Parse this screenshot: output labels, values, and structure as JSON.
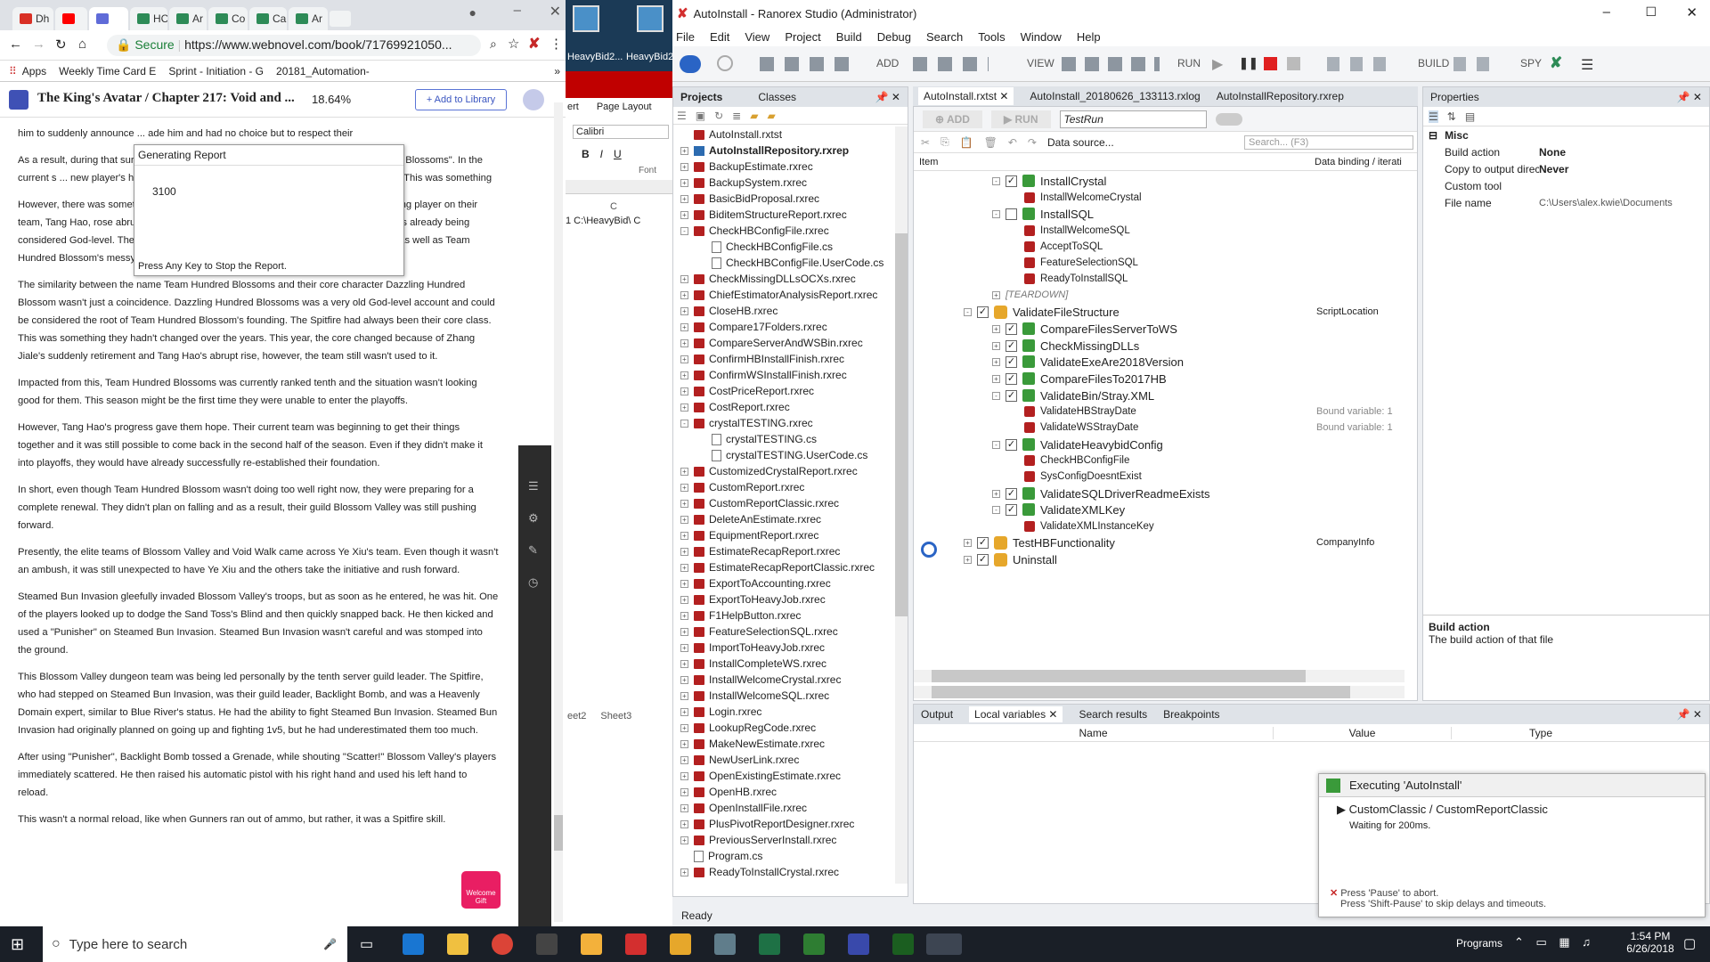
{
  "chrome": {
    "tabs": [
      {
        "label": "Dh",
        "color": "#d93025"
      },
      {
        "label": "",
        "color": "#ff0000"
      },
      {
        "label": "",
        "color": "#5f6bd8"
      },
      {
        "label": "HC",
        "color": "#2e8b57"
      },
      {
        "label": "Ar",
        "color": "#2e8b57"
      },
      {
        "label": "Co",
        "color": "#2e8b57"
      },
      {
        "label": "Ca",
        "color": "#2e8b57"
      },
      {
        "label": "Ar",
        "color": "#2e8b57"
      }
    ],
    "secure_label": "Secure",
    "url": "https://www.webnovel.com/book/71769921050...",
    "bookmarks": [
      "Apps",
      "Weekly Time Card E",
      "Sprint - Initiation - G",
      "20181_Automation-"
    ],
    "novel_title": "The King's Avatar / Chapter 217: Void and ...",
    "progress": "18.64%",
    "add_library": "+ Add to Library",
    "paragraphs": [
      "him to suddenly announce ... ade him and had no choice but to respect their",
      "As a result, during that sur ... someone to replace him. However, in the end, ... Hundred Blossoms\". In the current s ... new player's hands. The new player's performa ... become the team's core. This was something",
      "However, there was something this season that made them pleasantly surprised. A young player on their team, Tang Hao, rose abruptly during his second year as a pro and his performance was already being considered God-level. The only thing restricting him was his average Brawler account, as well as Team Hundred Blossom's messy playing.",
      "The similarity between the name Team Hundred Blossoms and their core character Dazzling Hundred Blossom wasn't just a coincidence. Dazzling Hundred Blossoms was a very old God-level account and could be considered the root of Team Hundred Blossom's founding. The Spitfire had always been their core class. This was something they hadn't changed over the years. This year, the core changed because of Zhang Jiale's suddenly retirement and Tang Hao's abrupt rise, however, the team still wasn't used to it.",
      "Impacted from this, Team Hundred Blossoms was currently ranked tenth and the situation wasn't looking good for them. This season might be the first time they were unable to enter the playoffs.",
      "However, Tang Hao's progress gave them hope. Their current team was beginning to get their things together and it was still possible to come back in the second half of the season. Even if they didn't make it into playoffs, they would have already successfully re-established their foundation.",
      "In short, even though Team Hundred Blossom wasn't doing too well right now, they were preparing for a complete renewal. They didn't plan on falling and as a result, their guild Blossom Valley was still pushing forward.",
      "Presently, the elite teams of Blossom Valley and Void Walk came across Ye Xiu's team. Even though it wasn't an ambush, it was still unexpected to have Ye Xiu and the others take the initiative and rush forward.",
      "Steamed Bun Invasion gleefully invaded Blossom Valley's troops, but as soon as he entered, he was hit. One of the players looked up to dodge the Sand Toss's Blind and then quickly snapped back. He then kicked and used a \"Punisher\" on Steamed Bun Invasion. Steamed Bun Invasion wasn't careful and was stomped into the ground.",
      "This Blossom Valley dungeon team was being led personally by the tenth server guild leader. The Spitfire, who had stepped on Steamed Bun Invasion, was their guild leader, Backlight Bomb, and was a Heavenly Domain expert, similar to Blue River's status. He had the ability to fight Steamed Bun Invasion. Steamed Bun Invasion had originally planned on going up and fighting 1v5, but he had underestimated them too much.",
      "After using \"Punisher\", Backlight Bomb tossed a Grenade, while shouting \"Scatter!\" Blossom Valley's players immediately scattered. He then raised his automatic pistol with his right hand and used his left hand to reload.",
      "This wasn't a normal reload, like when Gunners ran out of ammo, but rather, it was a Spitfire skill."
    ],
    "welcome_gift": "Welcome Gift"
  },
  "report_popup": {
    "title": "Generating Report",
    "value": "3100",
    "hint": "Press Any Key to Stop the Report."
  },
  "desktop": {
    "icons": [
      "HeavyBid2...",
      "HeavyBid2..."
    ]
  },
  "excel": {
    "tab": "ert",
    "page_layout": "Page Layout",
    "font": "Calibri",
    "font_group": "Font",
    "col": "C",
    "cell": "1  C:\\HeavyBid\\  C",
    "sheets": [
      "eet2",
      "Sheet3"
    ]
  },
  "ranorex": {
    "title": "AutoInstall - Ranorex Studio (Administrator)",
    "menu": [
      "File",
      "Edit",
      "View",
      "Project",
      "Build",
      "Debug",
      "Search",
      "Tools",
      "Window",
      "Help"
    ],
    "toolbar": {
      "add": "ADD",
      "view": "VIEW",
      "run": "RUN",
      "build": "BUILD",
      "spy": "SPY"
    },
    "project_tabs": [
      "Projects",
      "Classes"
    ],
    "project_items": [
      {
        "t": "AutoInstall.rxtst",
        "i": "red",
        "lvl": 0,
        "pm": ""
      },
      {
        "t": "AutoInstallRepository.rxrep",
        "i": "rep",
        "lvl": 0,
        "pm": "+",
        "bold": true
      },
      {
        "t": "BackupEstimate.rxrec",
        "i": "red",
        "lvl": 0,
        "pm": "+"
      },
      {
        "t": "BackupSystem.rxrec",
        "i": "red",
        "lvl": 0,
        "pm": "+"
      },
      {
        "t": "BasicBidProposal.rxrec",
        "i": "red",
        "lvl": 0,
        "pm": "+"
      },
      {
        "t": "BiditemStructureReport.rxrec",
        "i": "red",
        "lvl": 0,
        "pm": "+"
      },
      {
        "t": "CheckHBConfigFile.rxrec",
        "i": "red",
        "lvl": 0,
        "pm": "-"
      },
      {
        "t": "CheckHBConfigFile.cs",
        "i": "cs",
        "lvl": 1,
        "pm": ""
      },
      {
        "t": "CheckHBConfigFile.UserCode.cs",
        "i": "cs",
        "lvl": 1,
        "pm": ""
      },
      {
        "t": "CheckMissingDLLsOCXs.rxrec",
        "i": "red",
        "lvl": 0,
        "pm": "+"
      },
      {
        "t": "ChiefEstimatorAnalysisReport.rxrec",
        "i": "red",
        "lvl": 0,
        "pm": "+"
      },
      {
        "t": "CloseHB.rxrec",
        "i": "red",
        "lvl": 0,
        "pm": "+"
      },
      {
        "t": "Compare17Folders.rxrec",
        "i": "red",
        "lvl": 0,
        "pm": "+"
      },
      {
        "t": "CompareServerAndWSBin.rxrec",
        "i": "red",
        "lvl": 0,
        "pm": "+"
      },
      {
        "t": "ConfirmHBInstallFinish.rxrec",
        "i": "red",
        "lvl": 0,
        "pm": "+"
      },
      {
        "t": "ConfirmWSInstallFinish.rxrec",
        "i": "red",
        "lvl": 0,
        "pm": "+"
      },
      {
        "t": "CostPriceReport.rxrec",
        "i": "red",
        "lvl": 0,
        "pm": "+"
      },
      {
        "t": "CostReport.rxrec",
        "i": "red",
        "lvl": 0,
        "pm": "+"
      },
      {
        "t": "crystalTESTING.rxrec",
        "i": "red",
        "lvl": 0,
        "pm": "-"
      },
      {
        "t": "crystalTESTING.cs",
        "i": "cs",
        "lvl": 1,
        "pm": ""
      },
      {
        "t": "crystalTESTING.UserCode.cs",
        "i": "cs",
        "lvl": 1,
        "pm": ""
      },
      {
        "t": "CustomizedCrystalReport.rxrec",
        "i": "red",
        "lvl": 0,
        "pm": "+"
      },
      {
        "t": "CustomReport.rxrec",
        "i": "red",
        "lvl": 0,
        "pm": "+"
      },
      {
        "t": "CustomReportClassic.rxrec",
        "i": "red",
        "lvl": 0,
        "pm": "+"
      },
      {
        "t": "DeleteAnEstimate.rxrec",
        "i": "red",
        "lvl": 0,
        "pm": "+"
      },
      {
        "t": "EquipmentReport.rxrec",
        "i": "red",
        "lvl": 0,
        "pm": "+"
      },
      {
        "t": "EstimateRecapReport.rxrec",
        "i": "red",
        "lvl": 0,
        "pm": "+"
      },
      {
        "t": "EstimateRecapReportClassic.rxrec",
        "i": "red",
        "lvl": 0,
        "pm": "+"
      },
      {
        "t": "ExportToAccounting.rxrec",
        "i": "red",
        "lvl": 0,
        "pm": "+"
      },
      {
        "t": "ExportToHeavyJob.rxrec",
        "i": "red",
        "lvl": 0,
        "pm": "+"
      },
      {
        "t": "F1HelpButton.rxrec",
        "i": "red",
        "lvl": 0,
        "pm": "+"
      },
      {
        "t": "FeatureSelectionSQL.rxrec",
        "i": "red",
        "lvl": 0,
        "pm": "+"
      },
      {
        "t": "ImportToHeavyJob.rxrec",
        "i": "red",
        "lvl": 0,
        "pm": "+"
      },
      {
        "t": "InstallCompleteWS.rxrec",
        "i": "red",
        "lvl": 0,
        "pm": "+"
      },
      {
        "t": "InstallWelcomeCrystal.rxrec",
        "i": "red",
        "lvl": 0,
        "pm": "+"
      },
      {
        "t": "InstallWelcomeSQL.rxrec",
        "i": "red",
        "lvl": 0,
        "pm": "+"
      },
      {
        "t": "Login.rxrec",
        "i": "red",
        "lvl": 0,
        "pm": "+"
      },
      {
        "t": "LookupRegCode.rxrec",
        "i": "red",
        "lvl": 0,
        "pm": "+"
      },
      {
        "t": "MakeNewEstimate.rxrec",
        "i": "red",
        "lvl": 0,
        "pm": "+"
      },
      {
        "t": "NewUserLink.rxrec",
        "i": "red",
        "lvl": 0,
        "pm": "+"
      },
      {
        "t": "OpenExistingEstimate.rxrec",
        "i": "red",
        "lvl": 0,
        "pm": "+"
      },
      {
        "t": "OpenHB.rxrec",
        "i": "red",
        "lvl": 0,
        "pm": "+"
      },
      {
        "t": "OpenInstallFile.rxrec",
        "i": "red",
        "lvl": 0,
        "pm": "+"
      },
      {
        "t": "PlusPivotReportDesigner.rxrec",
        "i": "red",
        "lvl": 0,
        "pm": "+"
      },
      {
        "t": "PreviousServerInstall.rxrec",
        "i": "red",
        "lvl": 0,
        "pm": "+"
      },
      {
        "t": "Program.cs",
        "i": "cs",
        "lvl": 0,
        "pm": ""
      },
      {
        "t": "ReadyToInstallCrystal.rxrec",
        "i": "red",
        "lvl": 0,
        "pm": "+"
      }
    ],
    "doc_tabs": [
      "AutoInstall.rxtst",
      "AutoInstall_20180626_133113.rxlog",
      "AutoInstallRepository.rxrep"
    ],
    "suite_toolbar": {
      "add": "ADD",
      "run": "RUN",
      "testrun": "TestRun",
      "datasource": "Data source...",
      "search": "Search... (F3)"
    },
    "suite_cols": [
      "Item",
      "Data binding / iterati"
    ],
    "suite_rows": [
      {
        "t": "InstallCrystal",
        "k": "tc",
        "lvl": 2,
        "cb": "x",
        "pm": "-"
      },
      {
        "t": "InstallWelcomeCrystal",
        "k": "mod",
        "lvl": 3
      },
      {
        "t": "InstallSQL",
        "k": "tc",
        "lvl": 2,
        "cb": " ",
        "pm": "-"
      },
      {
        "t": "InstallWelcomeSQL",
        "k": "mod",
        "lvl": 3
      },
      {
        "t": "AcceptToSQL",
        "k": "mod",
        "lvl": 3
      },
      {
        "t": "FeatureSelectionSQL",
        "k": "mod",
        "lvl": 3
      },
      {
        "t": "ReadyToInstallSQL",
        "k": "mod",
        "lvl": 3
      },
      {
        "t": "[TEARDOWN]",
        "k": "td",
        "lvl": 2,
        "pm": "+"
      },
      {
        "t": "ValidateFileStructure",
        "k": "gear",
        "lvl": 1,
        "cb": "x",
        "pm": "-",
        "bind": "ScriptLocation"
      },
      {
        "t": "CompareFilesServerToWS",
        "k": "tc",
        "lvl": 2,
        "cb": "x",
        "pm": "+"
      },
      {
        "t": "CheckMissingDLLs",
        "k": "tc",
        "lvl": 2,
        "cb": "x",
        "pm": "+"
      },
      {
        "t": "ValidateExeAre2018Version",
        "k": "tc",
        "lvl": 2,
        "cb": "x",
        "pm": "+"
      },
      {
        "t": "CompareFilesTo2017HB",
        "k": "tc",
        "lvl": 2,
        "cb": "x",
        "pm": "+"
      },
      {
        "t": "ValidateBin/Stray.XML",
        "k": "tc",
        "lvl": 2,
        "cb": "x",
        "pm": "-"
      },
      {
        "t": "ValidateHBStrayDate",
        "k": "mod",
        "lvl": 3,
        "bind": "Bound variable: 1"
      },
      {
        "t": "ValidateWSStrayDate",
        "k": "mod",
        "lvl": 3,
        "bind": "Bound variable: 1"
      },
      {
        "t": "ValidateHeavybidConfig",
        "k": "tc",
        "lvl": 2,
        "cb": "x",
        "pm": "-"
      },
      {
        "t": "CheckHBConfigFile",
        "k": "mod",
        "lvl": 3
      },
      {
        "t": "SysConfigDoesntExist",
        "k": "mod",
        "lvl": 3
      },
      {
        "t": "ValidateSQLDriverReadmeExists",
        "k": "tc",
        "lvl": 2,
        "cb": "x",
        "pm": "+"
      },
      {
        "t": "ValidateXMLKey",
        "k": "tc",
        "lvl": 2,
        "cb": "x",
        "pm": "-"
      },
      {
        "t": "ValidateXMLInstanceKey",
        "k": "mod",
        "lvl": 3
      },
      {
        "t": "TestHBFunctionality",
        "k": "gear",
        "lvl": 1,
        "cb": "x",
        "pm": "+",
        "bind": "CompanyInfo"
      },
      {
        "t": "Uninstall",
        "k": "gear",
        "lvl": 1,
        "cb": "x",
        "pm": "+"
      }
    ],
    "properties": {
      "title": "Properties",
      "category": "Misc",
      "rows": [
        {
          "k": "Build action",
          "v": "None"
        },
        {
          "k": "Copy to output director",
          "v": "Never"
        },
        {
          "k": "Custom tool",
          "v": ""
        },
        {
          "k": "File name",
          "v": "C:\\Users\\alex.kwie\\Documents"
        }
      ],
      "desc_title": "Build action",
      "desc_text": "The build action of that file"
    },
    "bottom_tabs": [
      "Output",
      "Local variables",
      "Search results",
      "Breakpoints"
    ],
    "bottom_cols": [
      "Name",
      "Value",
      "Type"
    ],
    "exec": {
      "title": "Executing 'AutoInstall'",
      "item": "CustomClassic / CustomReportClassic",
      "wait": "Waiting for 200ms.",
      "hint1": "Press 'Pause' to abort.",
      "hint2": "Press 'Shift-Pause' to skip delays and timeouts."
    },
    "status": "Ready"
  },
  "taskbar": {
    "search": "Type here to search",
    "programs": "Programs",
    "time": "1:54 PM",
    "date": "6/26/2018"
  }
}
